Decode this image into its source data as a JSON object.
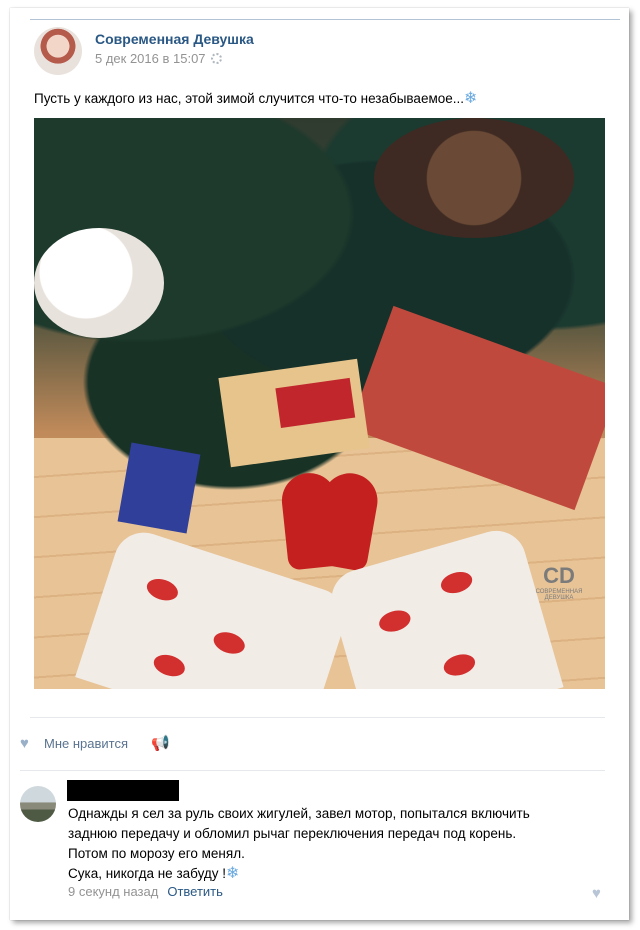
{
  "post": {
    "author": "Современная Девушка",
    "date": "5 дек 2016 в 15:07",
    "text": "Пусть у каждого из нас, этой зимой случится что-то незабываемое...",
    "text_emoji": "❄",
    "watermark": {
      "logo": "CD",
      "caption": "СОВРЕМЕННАЯ ДЕВУШКА"
    }
  },
  "actions": {
    "like_icon": "heart-icon",
    "like_label": "Мне нравится",
    "share_icon": "megaphone-icon"
  },
  "comment": {
    "lines": [
      "Однажды я сел за руль своих жигулей, завел мотор, попытался включить",
      "заднюю передачу и обломил рычаг переключения передач под корень.",
      "Потом по морозу его менял.",
      "Сука, никогда не забуду !"
    ],
    "emoji": "❄",
    "time": "9 секунд назад",
    "reply_label": "Ответить"
  },
  "colors": {
    "link": "#2a5885",
    "meta": "#939393",
    "icon": "#9aafc8"
  }
}
